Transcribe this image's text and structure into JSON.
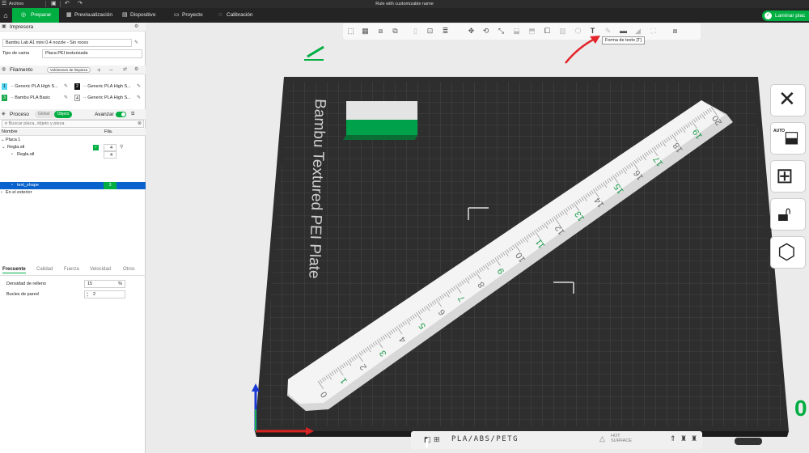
{
  "window": {
    "menu_label": "Archivo",
    "title": "Rule with customizable name"
  },
  "tabs": {
    "prepare": "Preparar",
    "preview": "Previsualización",
    "device": "Dispositivo",
    "project": "Proyecto",
    "calibration": "Calibración",
    "slice_button": "Laminar plac"
  },
  "printer": {
    "section_title": "Impresora",
    "printer_name": "Bambu Lab A1 mini 0.4 nozzle - Sin roces",
    "bed_type_label": "Tipo de cama",
    "bed_type_value": "Placa PEI texturizada"
  },
  "filament": {
    "section_title": "Filamento",
    "flush_button": "Volúmenes de limpieza",
    "slots": [
      {
        "num": "1",
        "name": "Generic PLA High S...",
        "color": "#56d6f2"
      },
      {
        "num": "2",
        "name": "Generic PLA High S...",
        "color": "#111111"
      },
      {
        "num": "3",
        "name": "Bambu PLA Basic",
        "color": "#1aa84a"
      },
      {
        "num": "4",
        "name": "Generic PLA High S...",
        "color": "#ffffff"
      }
    ]
  },
  "process": {
    "section_title": "Proceso",
    "global_label": "Global",
    "object_label": "Objeto",
    "advanced_label": "Avanzar",
    "search_placeholder": "Buscar placa, objeto y pieza",
    "col_name": "Nombre",
    "col_fil": "Fila.",
    "tree": {
      "plate": "Placa 1",
      "object": "Regla.stl",
      "object_fil": "4",
      "part": "Regla.stl",
      "part_fil": "4",
      "text_part": "text_shape",
      "text_part_fil": "3",
      "outside": "En el exterior"
    }
  },
  "settings": {
    "tabs": [
      "Frecuente",
      "Calidad",
      "Fuerza",
      "Velocidad",
      "Otros"
    ],
    "infill_label": "Densidad de relleno",
    "infill_value": "15",
    "infill_unit": "%",
    "walls_label": "Bucles de pared",
    "walls_value": "2"
  },
  "viewport": {
    "tooltip": "Forma de texto [T]",
    "plate_name": "Bambu Textured PEI Plate",
    "bed_strip": "PLA/ABS/PETG",
    "hot_label": "HOT",
    "surface_label": "SURFACE",
    "plate_number": "0",
    "ruler_numbers": [
      "0",
      "1",
      "2",
      "3",
      "4",
      "5",
      "6",
      "7",
      "8",
      "9",
      "10",
      "11",
      "12",
      "13",
      "14",
      "15",
      "16",
      "17",
      "18",
      "19",
      "20"
    ],
    "colors": {
      "accent": "#00ae42",
      "ruler_text_green": "#1b9a4a",
      "arrow_red": "#e3242b"
    }
  }
}
